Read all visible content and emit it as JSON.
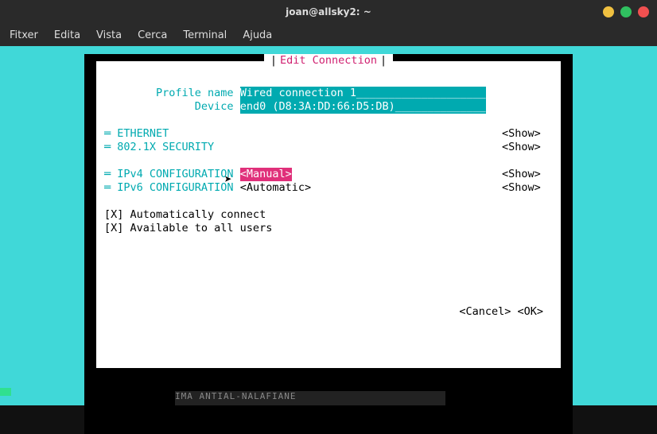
{
  "titlebar": {
    "text": "joan@allsky2: ~"
  },
  "menu": {
    "items": [
      "Fitxer",
      "Edita",
      "Vista",
      "Cerca",
      "Terminal",
      "Ajuda"
    ]
  },
  "dialog": {
    "title": "Edit Connection",
    "profile_label": "Profile name",
    "profile_value": "Wired connection 1",
    "device_label": "Device",
    "device_value": "end0 (D8:3A:DD:66:D5:DB)",
    "sections": {
      "ethernet": "ETHERNET",
      "security": "802.1X SECURITY",
      "ipv4": "IPv4 CONFIGURATION",
      "ipv6": "IPv6 CONFIGURATION"
    },
    "ipv4_mode": "<Manual>",
    "ipv6_mode": "<Automatic>",
    "show": "<Show>",
    "checkboxes": {
      "auto": "[X] Automatically connect",
      "allusers": "[X] Available to all users"
    },
    "cancel": "<Cancel>",
    "ok": "<OK>"
  },
  "bg_noise": "IMA ANTIAL-NALAFIANE"
}
